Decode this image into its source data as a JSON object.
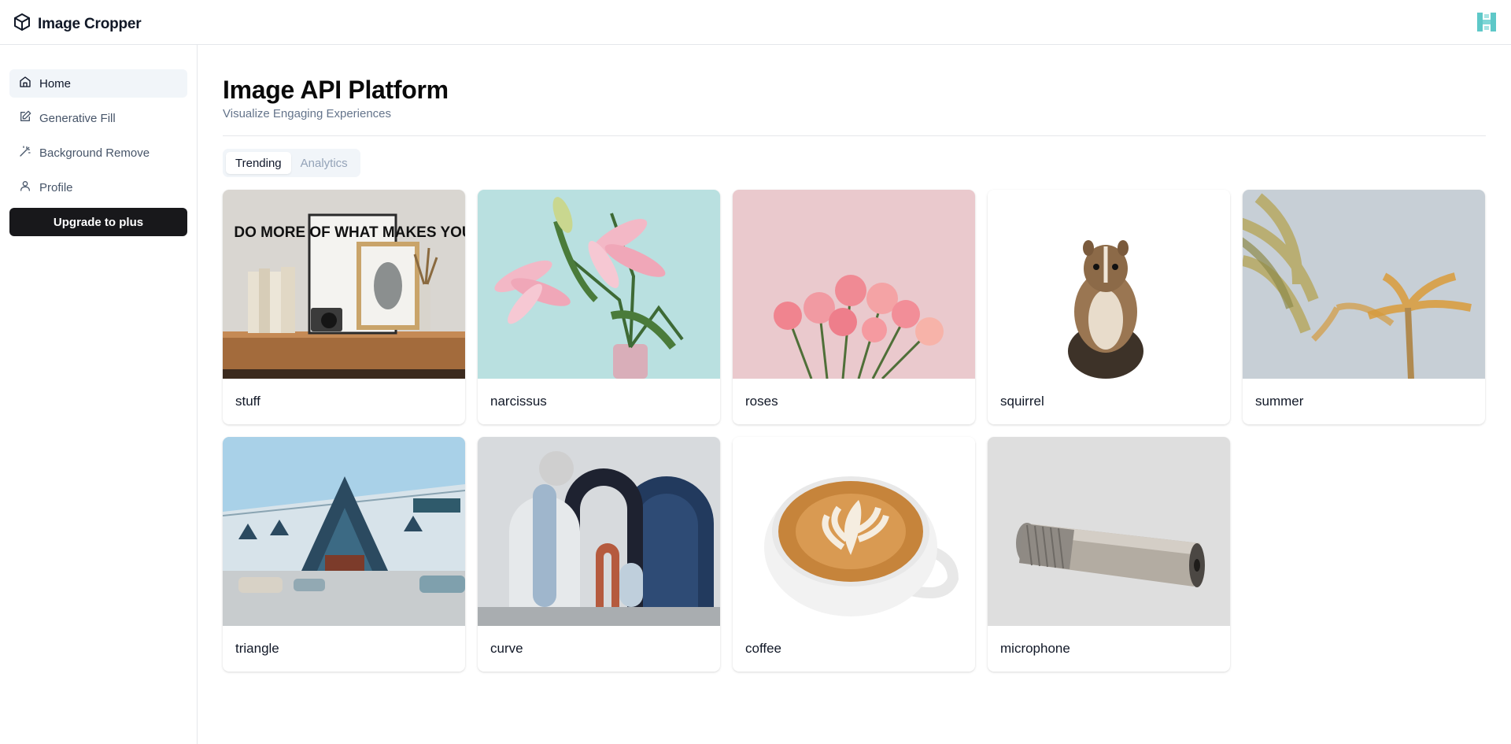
{
  "app": {
    "name": "Image Cropper"
  },
  "sidebar": {
    "items": [
      {
        "label": "Home",
        "icon": "home-icon",
        "active": true
      },
      {
        "label": "Generative Fill",
        "icon": "edit-icon",
        "active": false
      },
      {
        "label": "Background Remove",
        "icon": "magic-wand-icon",
        "active": false
      },
      {
        "label": "Profile",
        "icon": "user-icon",
        "active": false
      }
    ],
    "upgrade_label": "Upgrade to plus"
  },
  "main": {
    "title": "Image API Platform",
    "subtitle": "Visualize Engaging Experiences",
    "tabs": [
      {
        "label": "Trending",
        "active": true
      },
      {
        "label": "Analytics",
        "active": false
      }
    ],
    "cards": [
      {
        "label": "stuff"
      },
      {
        "label": "narcissus"
      },
      {
        "label": "roses"
      },
      {
        "label": "squirrel"
      },
      {
        "label": "summer"
      },
      {
        "label": "triangle"
      },
      {
        "label": "curve"
      },
      {
        "label": "coffee"
      },
      {
        "label": "microphone"
      }
    ],
    "poster_text": "DO MORE OF WHAT MAKES YOU"
  },
  "colors": {
    "accent": "#18181b",
    "avatar": "#5ec8c8",
    "border": "#e5e7eb"
  }
}
